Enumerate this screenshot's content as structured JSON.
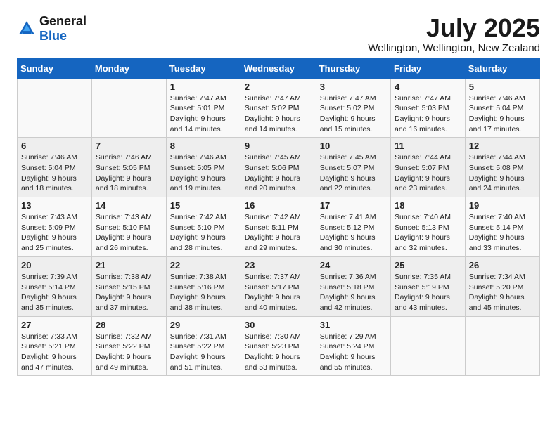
{
  "logo": {
    "text_general": "General",
    "text_blue": "Blue"
  },
  "title": "July 2025",
  "subtitle": "Wellington, Wellington, New Zealand",
  "days_of_week": [
    "Sunday",
    "Monday",
    "Tuesday",
    "Wednesday",
    "Thursday",
    "Friday",
    "Saturday"
  ],
  "weeks": [
    [
      {
        "day": "",
        "detail": ""
      },
      {
        "day": "",
        "detail": ""
      },
      {
        "day": "1",
        "detail": "Sunrise: 7:47 AM\nSunset: 5:01 PM\nDaylight: 9 hours\nand 14 minutes."
      },
      {
        "day": "2",
        "detail": "Sunrise: 7:47 AM\nSunset: 5:02 PM\nDaylight: 9 hours\nand 14 minutes."
      },
      {
        "day": "3",
        "detail": "Sunrise: 7:47 AM\nSunset: 5:02 PM\nDaylight: 9 hours\nand 15 minutes."
      },
      {
        "day": "4",
        "detail": "Sunrise: 7:47 AM\nSunset: 5:03 PM\nDaylight: 9 hours\nand 16 minutes."
      },
      {
        "day": "5",
        "detail": "Sunrise: 7:46 AM\nSunset: 5:04 PM\nDaylight: 9 hours\nand 17 minutes."
      }
    ],
    [
      {
        "day": "6",
        "detail": "Sunrise: 7:46 AM\nSunset: 5:04 PM\nDaylight: 9 hours\nand 18 minutes."
      },
      {
        "day": "7",
        "detail": "Sunrise: 7:46 AM\nSunset: 5:05 PM\nDaylight: 9 hours\nand 18 minutes."
      },
      {
        "day": "8",
        "detail": "Sunrise: 7:46 AM\nSunset: 5:05 PM\nDaylight: 9 hours\nand 19 minutes."
      },
      {
        "day": "9",
        "detail": "Sunrise: 7:45 AM\nSunset: 5:06 PM\nDaylight: 9 hours\nand 20 minutes."
      },
      {
        "day": "10",
        "detail": "Sunrise: 7:45 AM\nSunset: 5:07 PM\nDaylight: 9 hours\nand 22 minutes."
      },
      {
        "day": "11",
        "detail": "Sunrise: 7:44 AM\nSunset: 5:07 PM\nDaylight: 9 hours\nand 23 minutes."
      },
      {
        "day": "12",
        "detail": "Sunrise: 7:44 AM\nSunset: 5:08 PM\nDaylight: 9 hours\nand 24 minutes."
      }
    ],
    [
      {
        "day": "13",
        "detail": "Sunrise: 7:43 AM\nSunset: 5:09 PM\nDaylight: 9 hours\nand 25 minutes."
      },
      {
        "day": "14",
        "detail": "Sunrise: 7:43 AM\nSunset: 5:10 PM\nDaylight: 9 hours\nand 26 minutes."
      },
      {
        "day": "15",
        "detail": "Sunrise: 7:42 AM\nSunset: 5:10 PM\nDaylight: 9 hours\nand 28 minutes."
      },
      {
        "day": "16",
        "detail": "Sunrise: 7:42 AM\nSunset: 5:11 PM\nDaylight: 9 hours\nand 29 minutes."
      },
      {
        "day": "17",
        "detail": "Sunrise: 7:41 AM\nSunset: 5:12 PM\nDaylight: 9 hours\nand 30 minutes."
      },
      {
        "day": "18",
        "detail": "Sunrise: 7:40 AM\nSunset: 5:13 PM\nDaylight: 9 hours\nand 32 minutes."
      },
      {
        "day": "19",
        "detail": "Sunrise: 7:40 AM\nSunset: 5:14 PM\nDaylight: 9 hours\nand 33 minutes."
      }
    ],
    [
      {
        "day": "20",
        "detail": "Sunrise: 7:39 AM\nSunset: 5:14 PM\nDaylight: 9 hours\nand 35 minutes."
      },
      {
        "day": "21",
        "detail": "Sunrise: 7:38 AM\nSunset: 5:15 PM\nDaylight: 9 hours\nand 37 minutes."
      },
      {
        "day": "22",
        "detail": "Sunrise: 7:38 AM\nSunset: 5:16 PM\nDaylight: 9 hours\nand 38 minutes."
      },
      {
        "day": "23",
        "detail": "Sunrise: 7:37 AM\nSunset: 5:17 PM\nDaylight: 9 hours\nand 40 minutes."
      },
      {
        "day": "24",
        "detail": "Sunrise: 7:36 AM\nSunset: 5:18 PM\nDaylight: 9 hours\nand 42 minutes."
      },
      {
        "day": "25",
        "detail": "Sunrise: 7:35 AM\nSunset: 5:19 PM\nDaylight: 9 hours\nand 43 minutes."
      },
      {
        "day": "26",
        "detail": "Sunrise: 7:34 AM\nSunset: 5:20 PM\nDaylight: 9 hours\nand 45 minutes."
      }
    ],
    [
      {
        "day": "27",
        "detail": "Sunrise: 7:33 AM\nSunset: 5:21 PM\nDaylight: 9 hours\nand 47 minutes."
      },
      {
        "day": "28",
        "detail": "Sunrise: 7:32 AM\nSunset: 5:22 PM\nDaylight: 9 hours\nand 49 minutes."
      },
      {
        "day": "29",
        "detail": "Sunrise: 7:31 AM\nSunset: 5:22 PM\nDaylight: 9 hours\nand 51 minutes."
      },
      {
        "day": "30",
        "detail": "Sunrise: 7:30 AM\nSunset: 5:23 PM\nDaylight: 9 hours\nand 53 minutes."
      },
      {
        "day": "31",
        "detail": "Sunrise: 7:29 AM\nSunset: 5:24 PM\nDaylight: 9 hours\nand 55 minutes."
      },
      {
        "day": "",
        "detail": ""
      },
      {
        "day": "",
        "detail": ""
      }
    ]
  ]
}
